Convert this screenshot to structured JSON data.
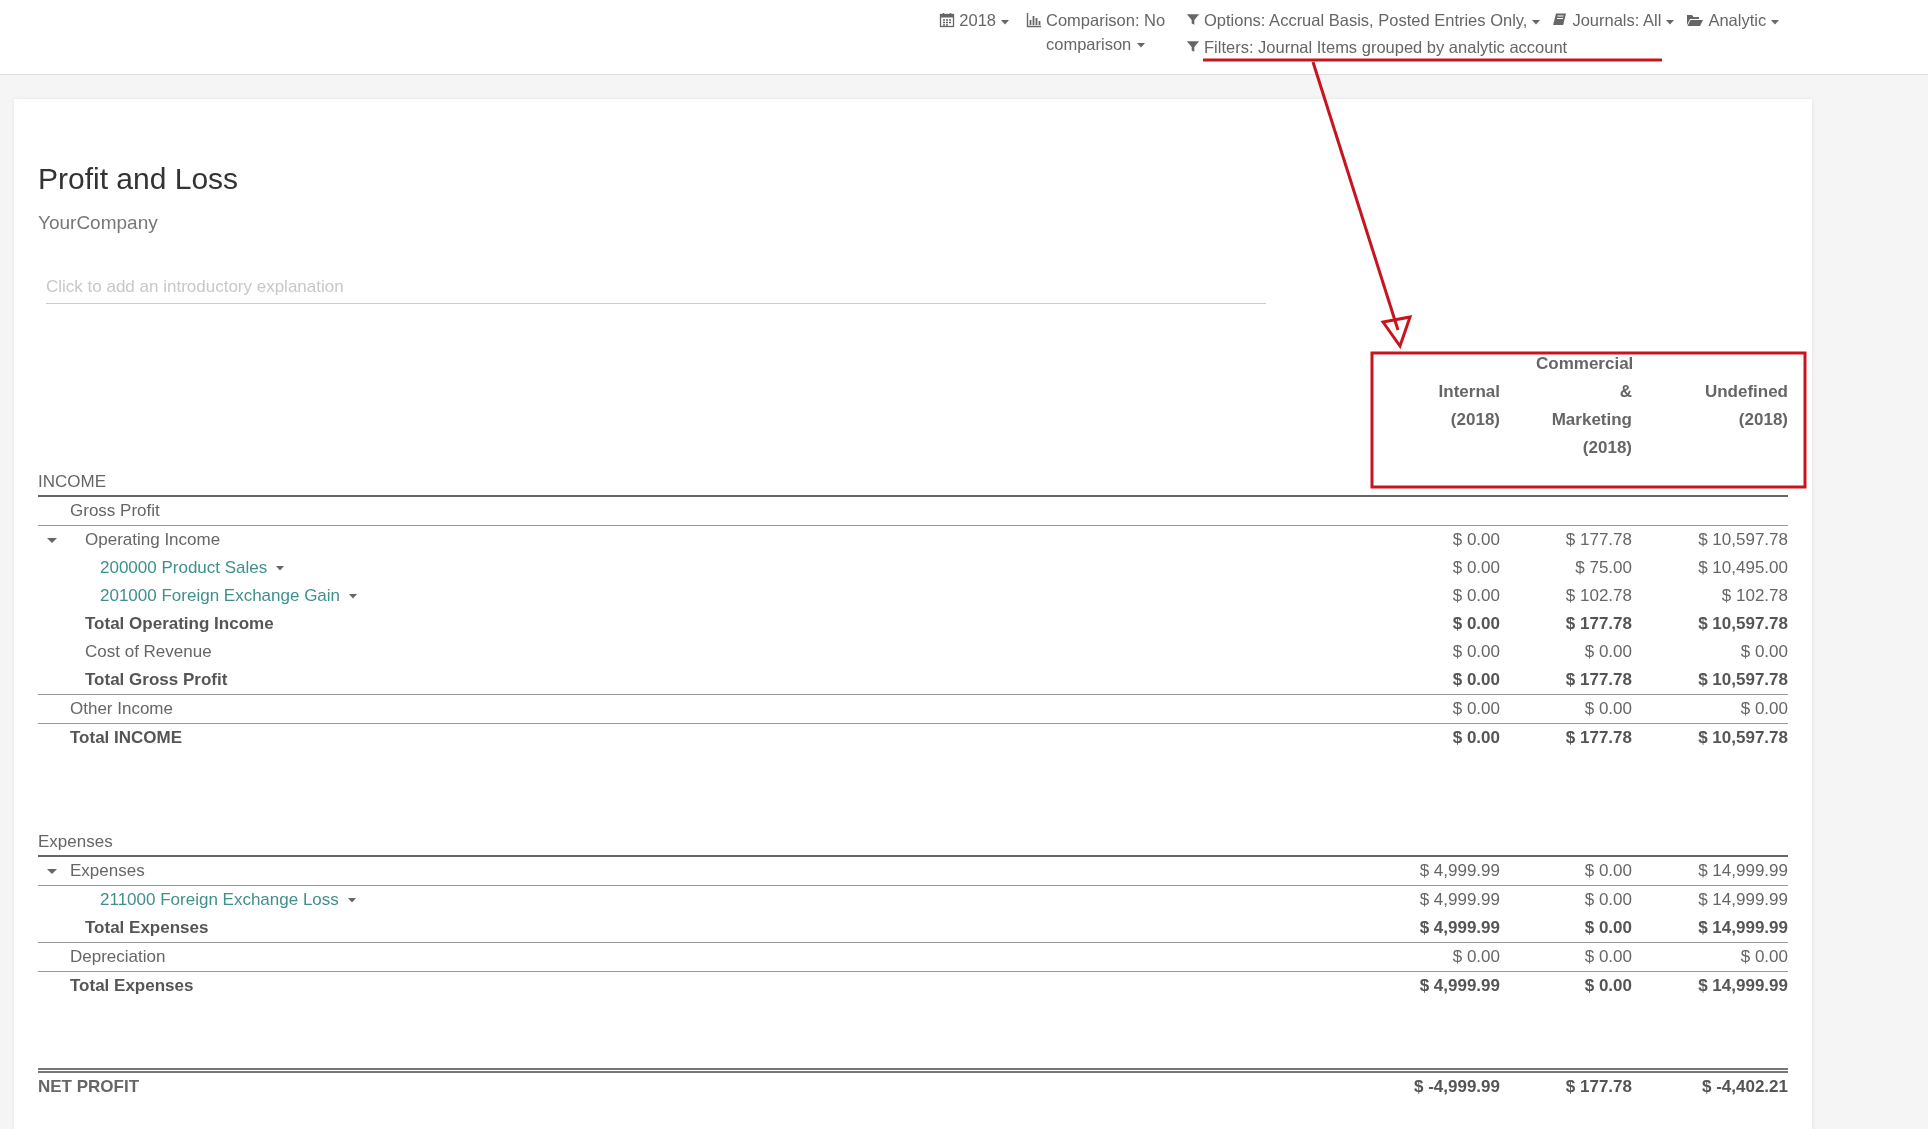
{
  "filters": [
    {
      "kind": "date",
      "label": "2018"
    },
    {
      "kind": "comparison",
      "label": "Comparison: No comparison"
    },
    {
      "kind": "options",
      "label": "Options: Accrual Basis, Posted Entries Only,"
    },
    {
      "kind": "journals",
      "label": "Journals: All"
    },
    {
      "kind": "analytic",
      "label": "Analytic"
    },
    {
      "kind": "filters",
      "label": "Filters: Journal Items grouped by analytic account"
    }
  ],
  "report": {
    "title": "Profit and Loss",
    "company": "YourCompany",
    "introduction": {
      "placeholder": "Click to add an introductory explanation"
    },
    "columns": [
      "Internal (2018)",
      "Commercial & Marketing (2018)",
      "Undefined (2018)"
    ],
    "sections": [
      {
        "label": "INCOME",
        "children": [
          {
            "kind": "group",
            "label": "Gross Profit",
            "children": [
              {
                "kind": "line",
                "label": "Operating Income",
                "expanded": true,
                "values": [
                  "$ 0.00",
                  "$ 177.78",
                  "$ 10,597.78"
                ],
                "children": [
                  {
                    "kind": "account",
                    "label": "200000 Product Sales",
                    "values": [
                      "$ 0.00",
                      "$ 75.00",
                      "$ 10,495.00"
                    ]
                  },
                  {
                    "kind": "account",
                    "label": "201000 Foreign Exchange Gain",
                    "values": [
                      "$ 0.00",
                      "$ 102.78",
                      "$ 102.78"
                    ]
                  }
                ]
              },
              {
                "kind": "total",
                "label": "Total Operating Income",
                "values": [
                  "$ 0.00",
                  "$ 177.78",
                  "$ 10,597.78"
                ]
              },
              {
                "kind": "line",
                "label": "Cost of Revenue",
                "values": [
                  "$ 0.00",
                  "$ 0.00",
                  "$ 0.00"
                ]
              },
              {
                "kind": "total",
                "label": "Total Gross Profit",
                "values": [
                  "$ 0.00",
                  "$ 177.78",
                  "$ 10,597.78"
                ]
              }
            ]
          },
          {
            "kind": "line",
            "label": "Other Income",
            "values": [
              "$ 0.00",
              "$ 0.00",
              "$ 0.00"
            ]
          },
          {
            "kind": "total",
            "label": "Total INCOME",
            "values": [
              "$ 0.00",
              "$ 177.78",
              "$ 10,597.78"
            ]
          }
        ]
      },
      {
        "label": "Expenses",
        "children": [
          {
            "kind": "line",
            "label": "Expenses",
            "expanded": true,
            "values": [
              "$ 4,999.99",
              "$ 0.00",
              "$ 14,999.99"
            ],
            "children": [
              {
                "kind": "account",
                "label": "211000 Foreign Exchange Loss",
                "values": [
                  "$ 4,999.99",
                  "$ 0.00",
                  "$ 14,999.99"
                ]
              },
              {
                "kind": "total",
                "label": "Total Expenses",
                "values": [
                  "$ 4,999.99",
                  "$ 0.00",
                  "$ 14,999.99"
                ]
              }
            ]
          },
          {
            "kind": "line",
            "label": "Depreciation",
            "values": [
              "$ 0.00",
              "$ 0.00",
              "$ 0.00"
            ]
          },
          {
            "kind": "total",
            "label": "Total Expenses",
            "values": [
              "$ 4,999.99",
              "$ 0.00",
              "$ 14,999.99"
            ]
          }
        ]
      }
    ],
    "net_profit": {
      "label": "NET PROFIT",
      "values": [
        "$ -4,999.99",
        "$ 177.78",
        "$ -4,402.21"
      ]
    }
  }
}
